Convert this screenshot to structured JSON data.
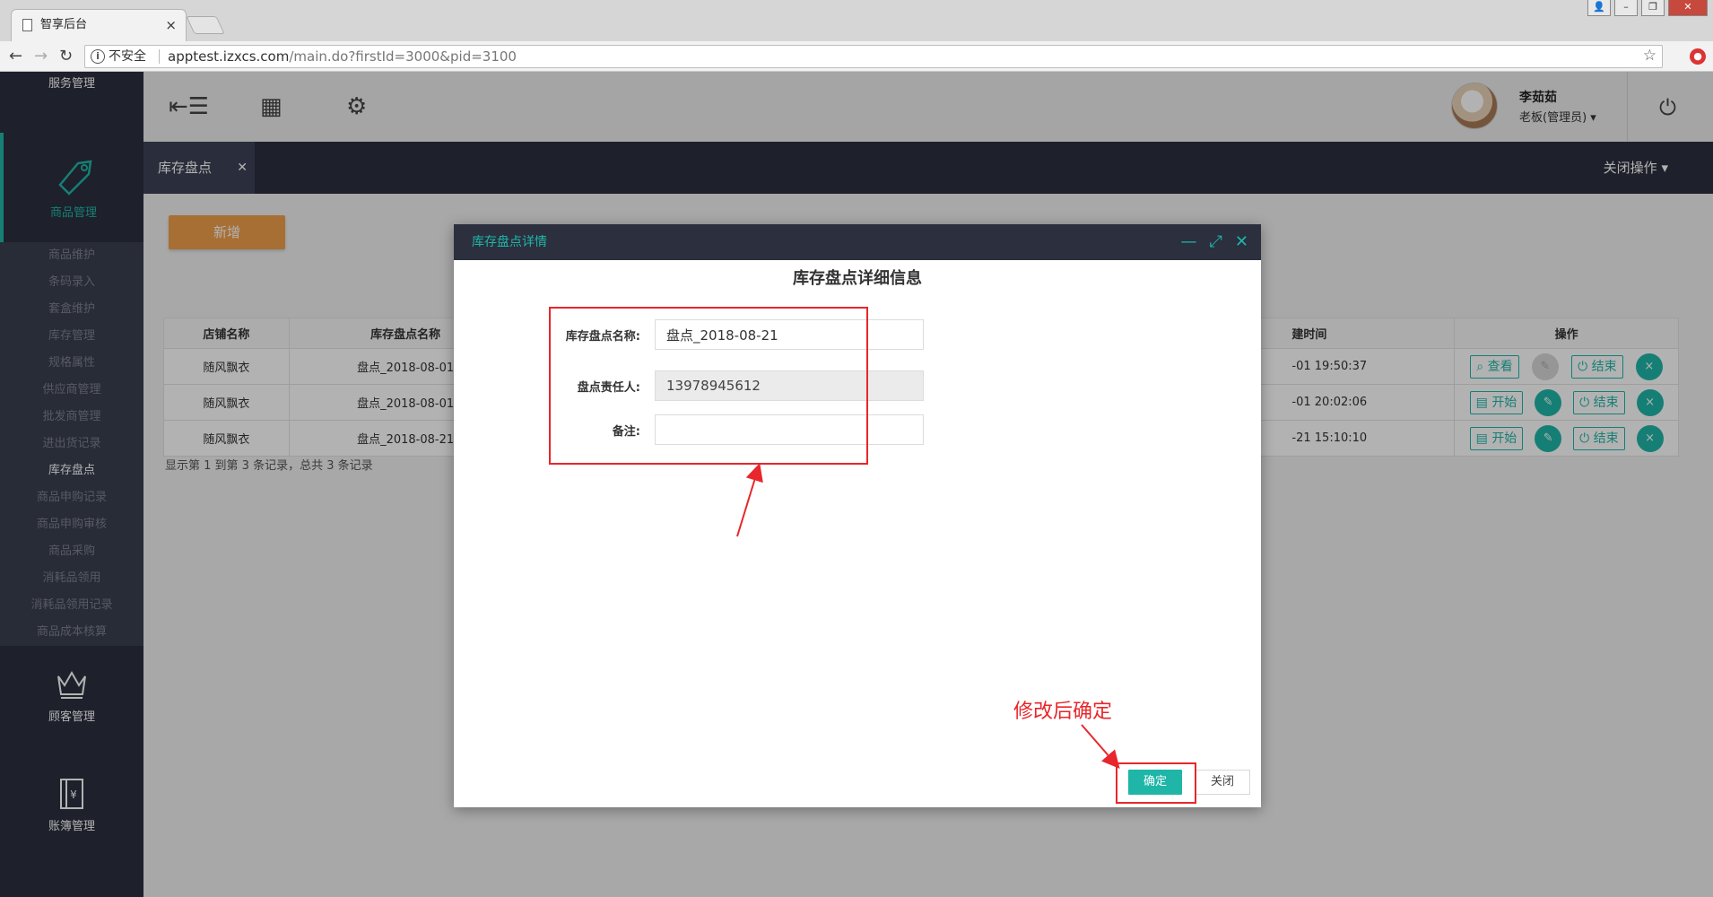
{
  "browser": {
    "tab_title": "智享后台",
    "insecure_label": "不安全",
    "url_host": "apptest.izxcs.com",
    "url_path": "/main.do?firstId=3000&pid=3100"
  },
  "sidebar": {
    "top_module": "服务管理",
    "active_module": "商品管理",
    "submenu": [
      "商品维护",
      "条码录入",
      "套盒维护",
      "库存管理",
      "规格属性",
      "供应商管理",
      "批发商管理",
      "进出货记录",
      "库存盘点",
      "商品申购记录",
      "商品申购审核",
      "商品采购",
      "消耗品领用",
      "消耗品领用记录",
      "商品成本核算"
    ],
    "current_sub": 8,
    "bottom_modules": [
      "顾客管理",
      "账簿管理"
    ]
  },
  "topbar": {
    "user_name": "李茹茹",
    "user_role": "老板(管理员)"
  },
  "tabs": {
    "page_tab": "库存盘点",
    "close_ops": "关闭操作"
  },
  "content": {
    "add_button": "新增",
    "columns": [
      "店铺名称",
      "库存盘点名称",
      "建时间",
      "操作"
    ],
    "rows": [
      {
        "shop": "随风飘衣",
        "name": "盘点_2018-08-01",
        "time": "-01 19:50:37",
        "primary": "查看",
        "edit_disabled": true
      },
      {
        "shop": "随风飘衣",
        "name": "盘点_2018-08-01",
        "time": "-01 20:02:06",
        "primary": "开始",
        "edit_disabled": false
      },
      {
        "shop": "随风飘衣",
        "name": "盘点_2018-08-21",
        "time": "-21 15:10:10",
        "primary": "开始",
        "edit_disabled": false
      }
    ],
    "end_label": "结束",
    "record_info": "显示第 1 到第 3 条记录，总共 3 条记录"
  },
  "modal": {
    "header": "库存盘点详情",
    "title": "库存盘点详细信息",
    "name_label": "库存盘点名称:",
    "name_value": "盘点_2018-08-21",
    "owner_label": "盘点责任人:",
    "owner_value": "13978945612",
    "note_label": "备注:",
    "note_value": "",
    "confirm": "确定",
    "close": "关闭"
  },
  "annotation": {
    "text": "修改后确定",
    "color": "#e8262b"
  },
  "colors": {
    "accent": "#1fb6a8",
    "sidebar_bg": "#2b2f3e",
    "add_button": "#f0a04b"
  }
}
